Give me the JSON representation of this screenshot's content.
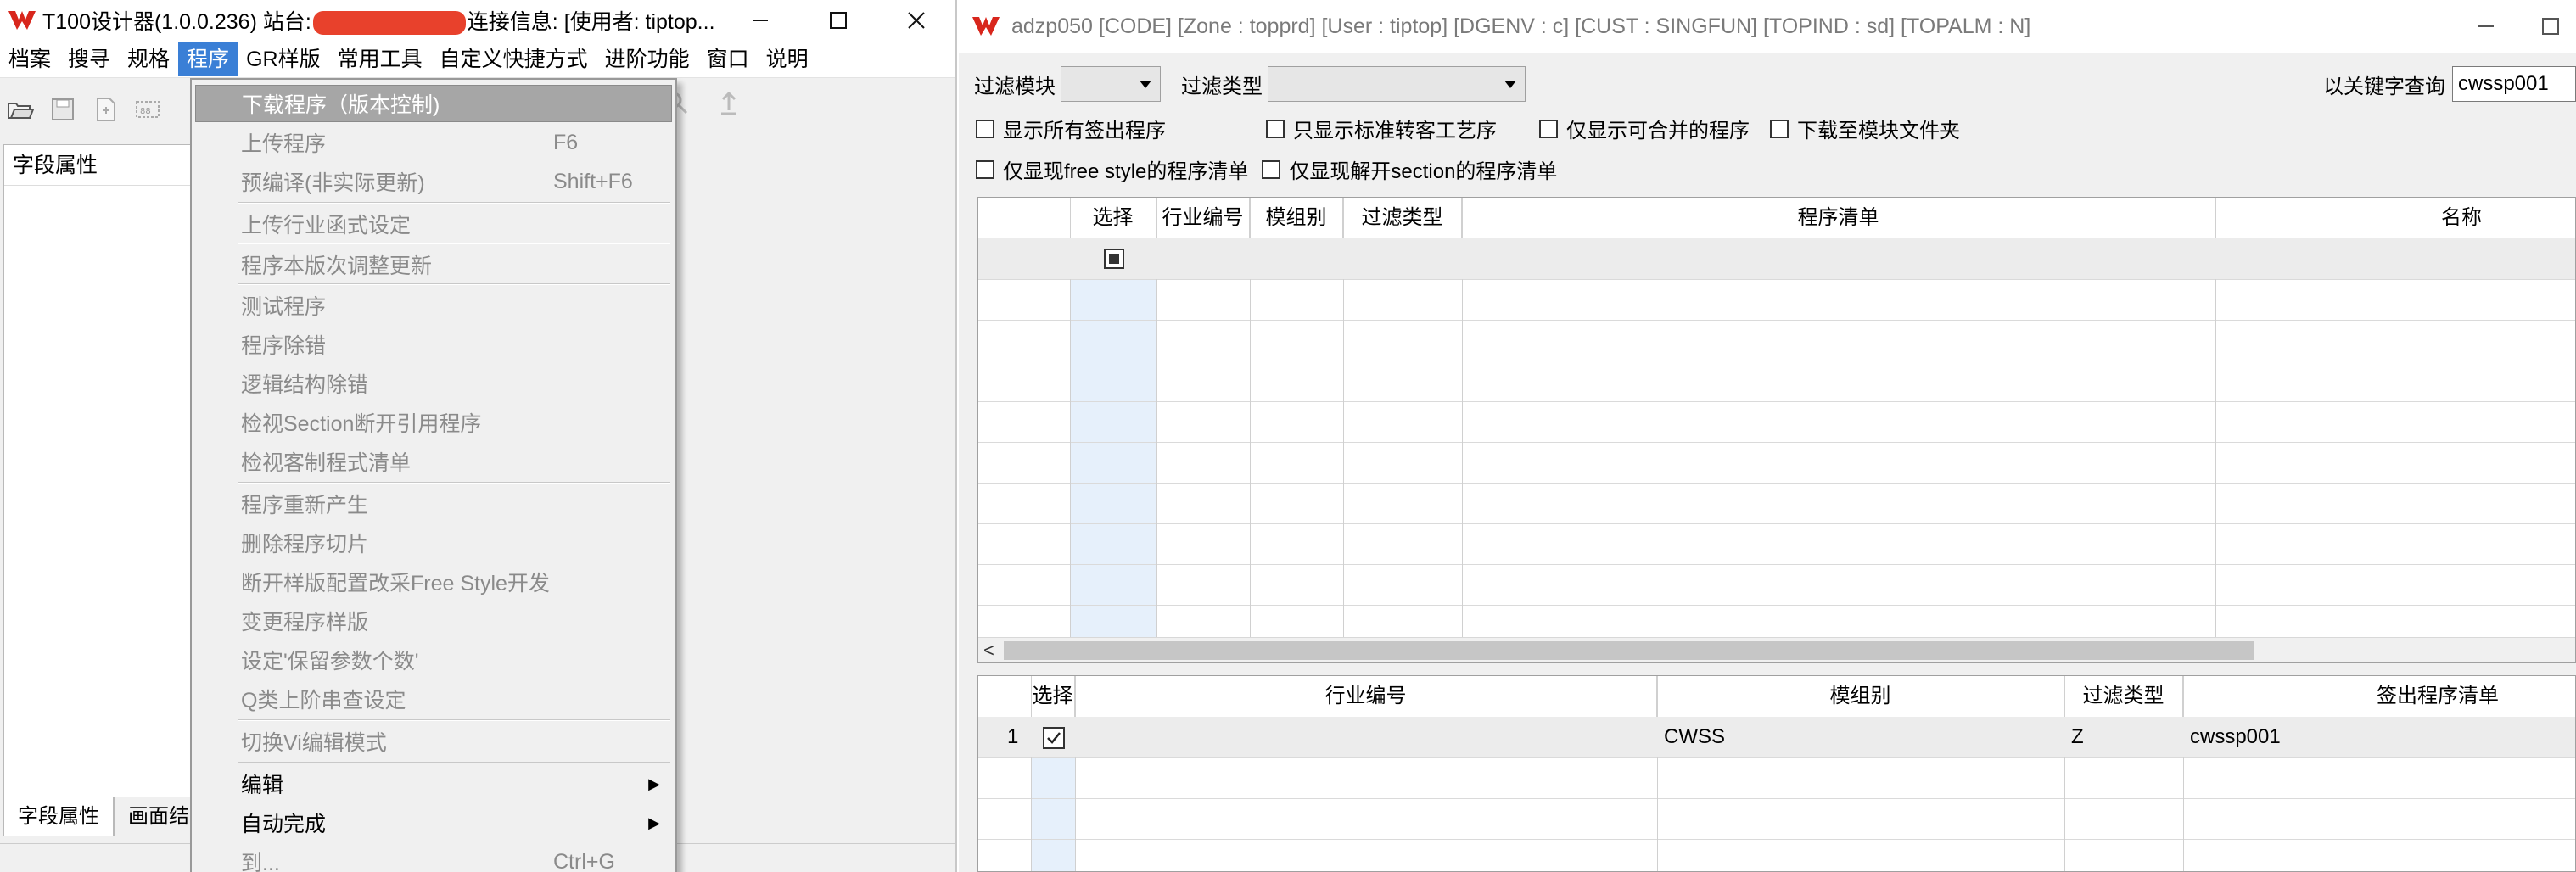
{
  "left_window": {
    "title_prefix": "T100设计器(1.0.0.236) 站台:",
    "title_suffix": "连接信息: [使用者: tiptop...",
    "menu": [
      "档案",
      "搜寻",
      "规格",
      "程序",
      "GR样版",
      "常用工具",
      "自定义快捷方式",
      "进阶功能",
      "窗口",
      "说明"
    ],
    "active_menu": "程序",
    "panel_header": "字段属性",
    "bottom_tabs": [
      "字段属性",
      "画面结"
    ]
  },
  "dropdown": {
    "items": [
      {
        "label": "下载程序（版本控制)",
        "shortcut": "",
        "state": "highlighted"
      },
      {
        "label": "上传程序",
        "shortcut": "F6",
        "state": "disabled"
      },
      {
        "label": "预编译(非实际更新)",
        "shortcut": "Shift+F6",
        "state": "disabled"
      },
      {
        "label": "上传行业函式设定",
        "shortcut": "",
        "state": "disabled"
      },
      {
        "label": "程序本版次调整更新",
        "shortcut": "",
        "state": "disabled"
      },
      {
        "label": "测试程序",
        "shortcut": "",
        "state": "disabled"
      },
      {
        "label": "程序除错",
        "shortcut": "",
        "state": "disabled"
      },
      {
        "label": "逻辑结构除错",
        "shortcut": "",
        "state": "disabled"
      },
      {
        "label": "检视Section断开引用程序",
        "shortcut": "",
        "state": "disabled"
      },
      {
        "label": "检视客制程式清单",
        "shortcut": "",
        "state": "disabled"
      },
      {
        "label": "程序重新产生",
        "shortcut": "",
        "state": "disabled"
      },
      {
        "label": "删除程序切片",
        "shortcut": "",
        "state": "disabled"
      },
      {
        "label": "断开样版配置改采Free Style开发",
        "shortcut": "",
        "state": "disabled"
      },
      {
        "label": "变更程序样版",
        "shortcut": "",
        "state": "disabled"
      },
      {
        "label": "设定'保留参数个数'",
        "shortcut": "",
        "state": "disabled"
      },
      {
        "label": "Q类上阶串查设定",
        "shortcut": "",
        "state": "disabled"
      },
      {
        "label": "切换Vi编辑模式",
        "shortcut": "",
        "state": "disabled"
      },
      {
        "label": "编辑",
        "shortcut": "",
        "state": "submenu"
      },
      {
        "label": "自动完成",
        "shortcut": "",
        "state": "submenu"
      },
      {
        "label": "到...",
        "shortcut": "Ctrl+G",
        "state": "disabled"
      }
    ]
  },
  "right_window": {
    "title": "adzp050 [CODE]  [Zone : topprd]  [User : tiptop]  [DGENV : c]  [CUST : SINGFUN]  [TOPIND : sd]  [TOPALM : N]",
    "filter_module_label": "过滤模块",
    "filter_type_label": "过滤类型",
    "keyword_label": "以关键字查询",
    "keyword_value": "cwssp001",
    "checkboxes_row1": [
      "显示所有签出程序",
      "只显示标准转客工艺序",
      "仅显示可合并的程序",
      "下载至模块文件夹"
    ],
    "checkboxes_row2": [
      "仅显现free style的程序清单",
      "仅显现解开section的程序清单"
    ],
    "top_grid_headers": [
      "选择",
      "行业编号",
      "模组别",
      "过滤类型",
      "程序清单",
      "名称"
    ],
    "bottom_grid_headers": [
      "选择",
      "行业编号",
      "模组别",
      "过滤类型",
      "签出程序清单"
    ],
    "bottom_grid_rows": [
      {
        "num": "1",
        "checked": true,
        "industry": "",
        "module": "CWSS",
        "filter": "Z",
        "program": "cwssp001"
      }
    ]
  }
}
